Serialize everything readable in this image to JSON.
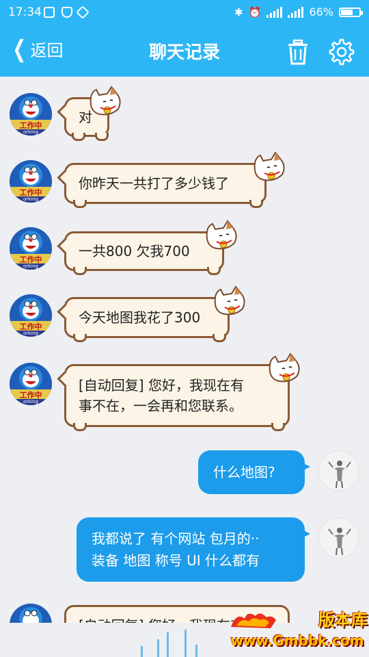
{
  "status_bar": {
    "time": "17:34",
    "battery_text": "66%",
    "battery_level": 0.66
  },
  "nav": {
    "back_label": "返回",
    "title": "聊天记录",
    "delete_icon": "trash-icon",
    "settings_icon": "gear-icon"
  },
  "avatar_text": {
    "left_banner": "工作中",
    "left_sub": "orking"
  },
  "messages": [
    {
      "side": "left",
      "text": "对"
    },
    {
      "side": "left",
      "text": "你昨天一共打了多少钱了"
    },
    {
      "side": "left",
      "text": "一共800  欠我700"
    },
    {
      "side": "left",
      "text": "今天地图我花了300"
    },
    {
      "side": "left",
      "line1": "[自动回复] 您好，我现在有",
      "line2": "事不在，一会再和您联系。"
    },
    {
      "side": "right",
      "text": "什么地图?"
    },
    {
      "side": "right",
      "line1": "我都说了 有个网站 包月的··",
      "line2": "装备 地图 称号 UI  什么都有"
    },
    {
      "side": "left",
      "text": "[自动回复] 您好，我现在有"
    }
  ],
  "watermark": {
    "brand": "版本库",
    "url": "www.Gmbbk.com"
  },
  "colors": {
    "accent": "#2DB6F5",
    "bubble_right": "#1C9CEA",
    "bubble_left_bg": "#FCF4E6",
    "bubble_left_border": "#8A5A34",
    "background": "#EDEFF3"
  }
}
